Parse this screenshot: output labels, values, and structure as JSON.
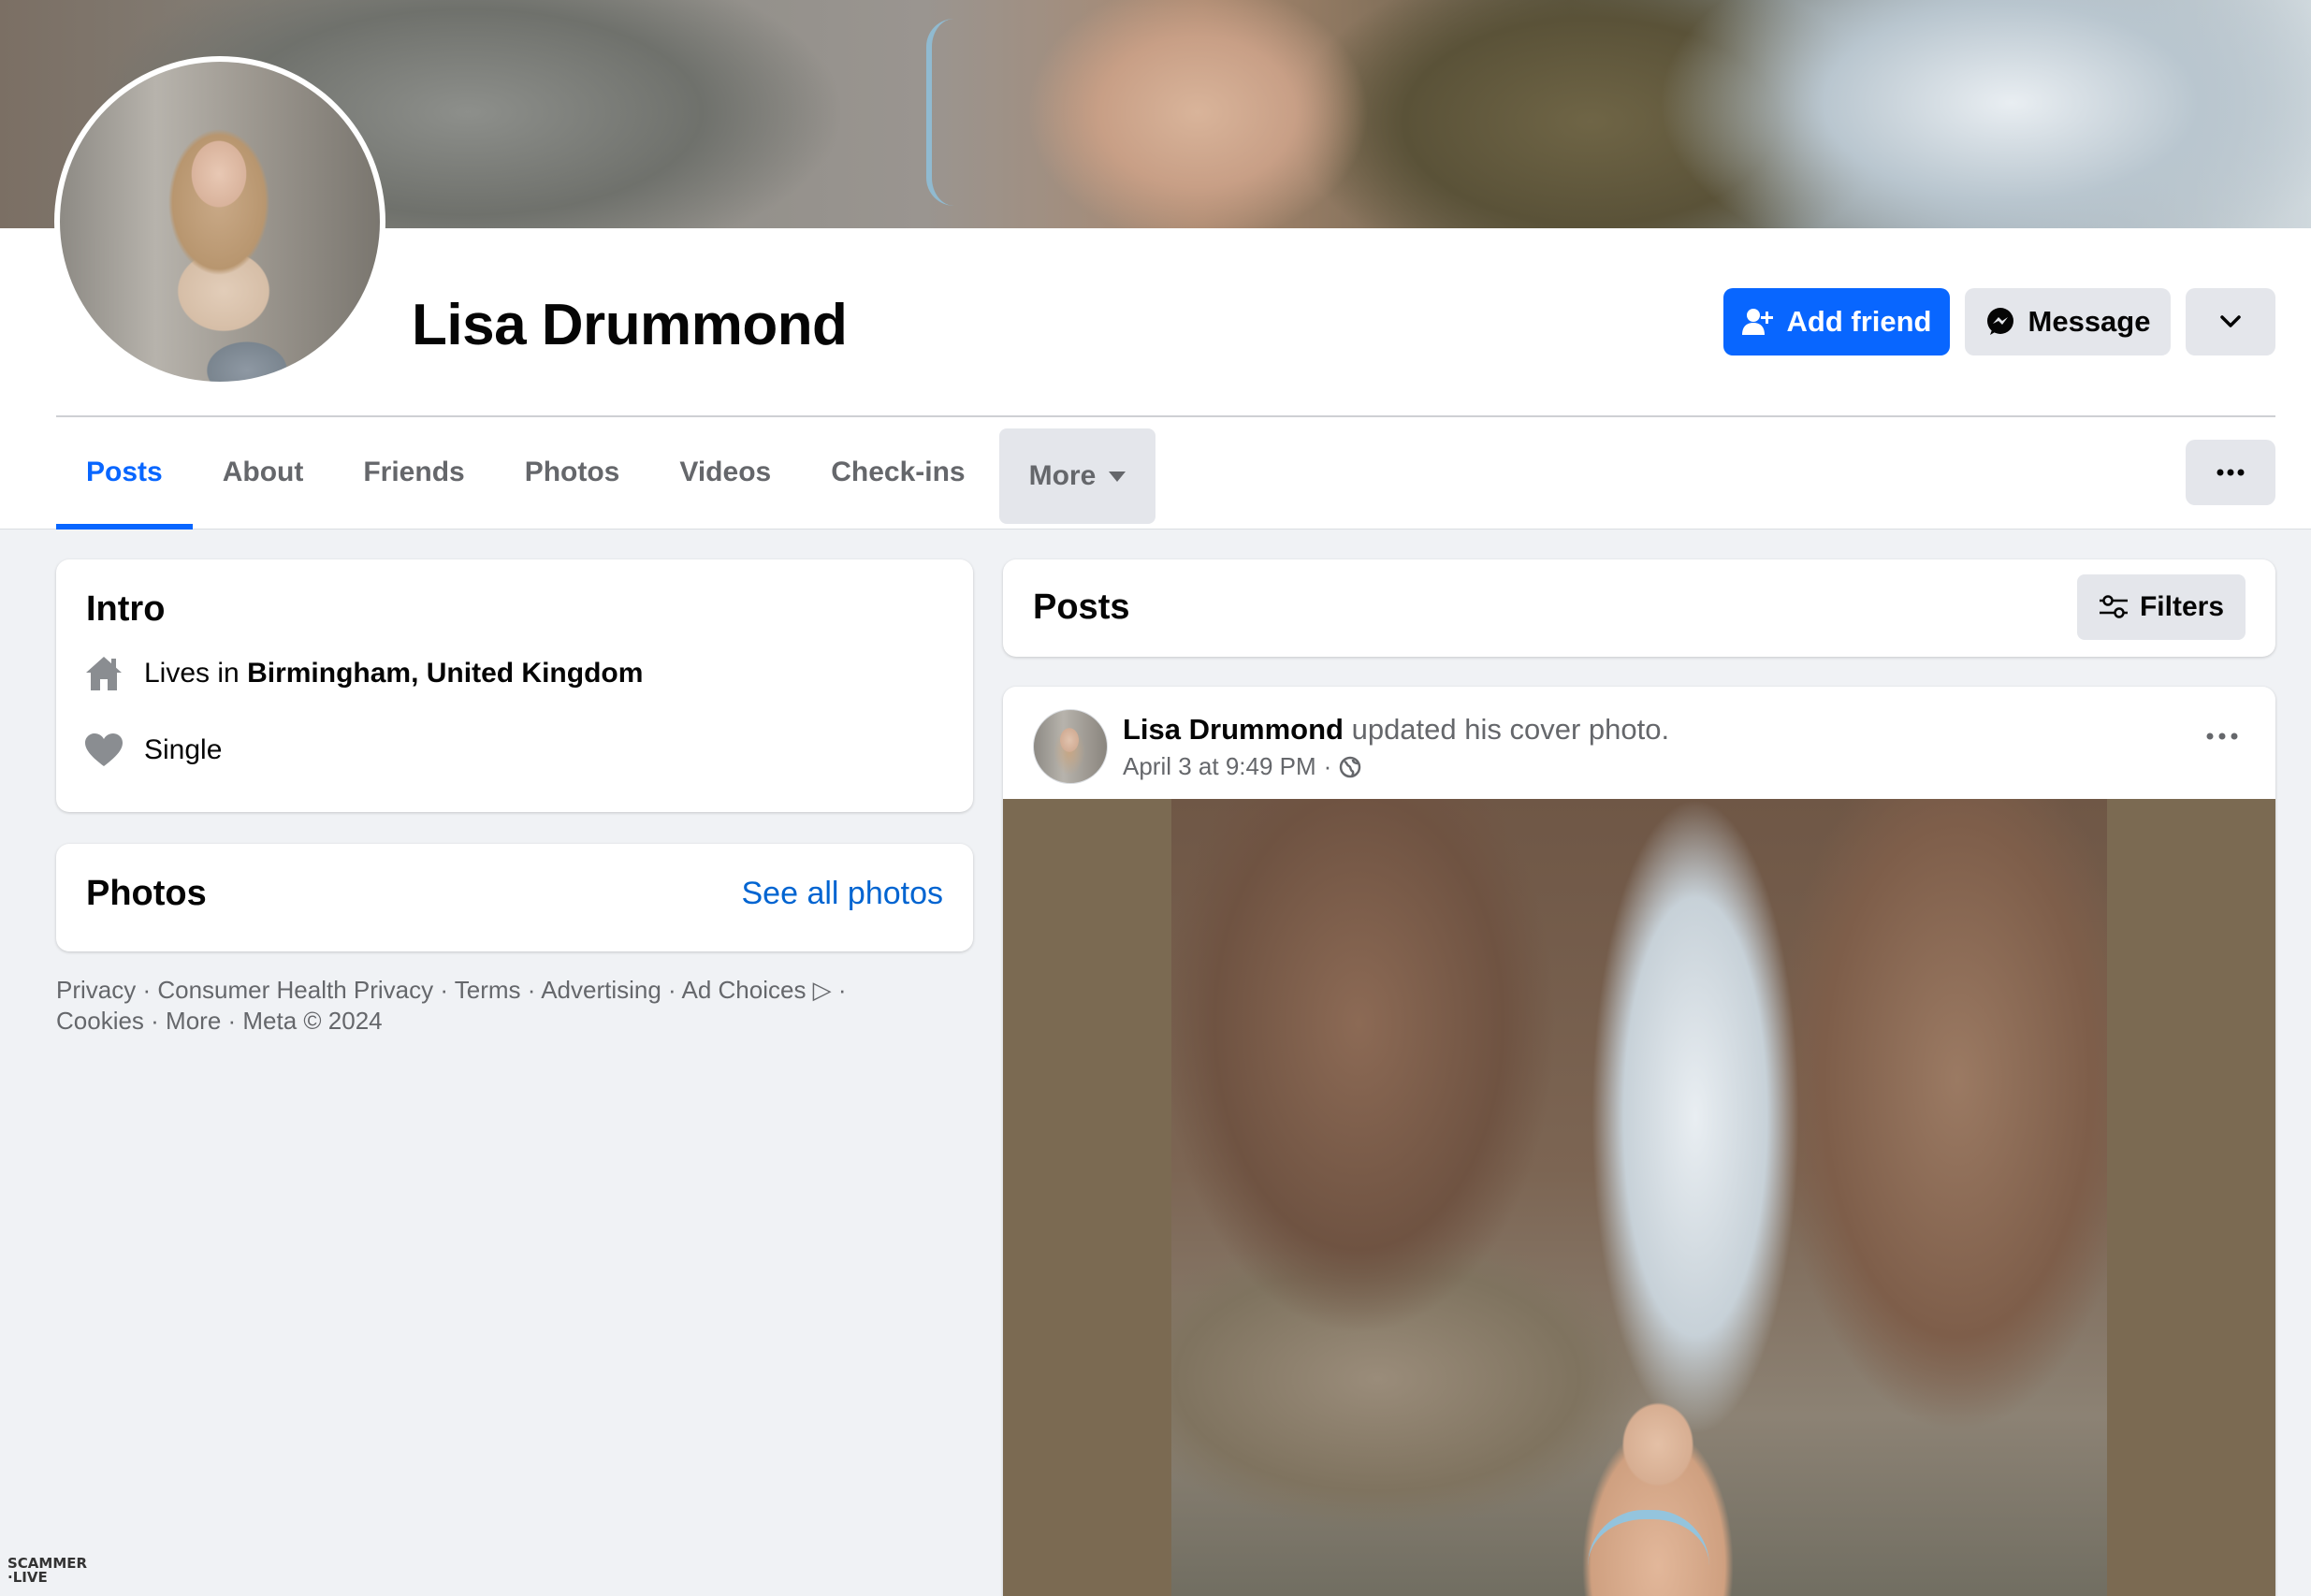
{
  "profile": {
    "name": "Lisa Drummond"
  },
  "actions": {
    "add_friend": "Add friend",
    "message": "Message"
  },
  "tabs": [
    {
      "label": "Posts",
      "active": true
    },
    {
      "label": "About"
    },
    {
      "label": "Friends"
    },
    {
      "label": "Photos"
    },
    {
      "label": "Videos"
    },
    {
      "label": "Check-ins"
    },
    {
      "label": "More"
    }
  ],
  "intro": {
    "title": "Intro",
    "lives_prefix": "Lives in ",
    "lives_place": "Birmingham, United Kingdom",
    "relationship": "Single"
  },
  "photos_card": {
    "title": "Photos",
    "see_all": "See all photos"
  },
  "footer": {
    "line1": "Privacy · Consumer Health Privacy · Terms · Advertising · Ad Choices ▷ ·",
    "line2": "Cookies · More · Meta © 2024"
  },
  "posts_header": {
    "title": "Posts",
    "filters": "Filters"
  },
  "post": {
    "author": "Lisa Drummond",
    "action": " updated his cover photo.",
    "timestamp": "April 3 at 9:49 PM",
    "separator": "·",
    "privacy_icon": "globe-icon"
  },
  "watermark": {
    "line1": "SCAMMER",
    "line2": "·LIVE"
  },
  "colors": {
    "accent": "#0866ff",
    "button_gray": "#e4e6eb",
    "page_bg": "#f0f2f5",
    "secondary_text": "#65676b",
    "link": "#0064d1"
  }
}
